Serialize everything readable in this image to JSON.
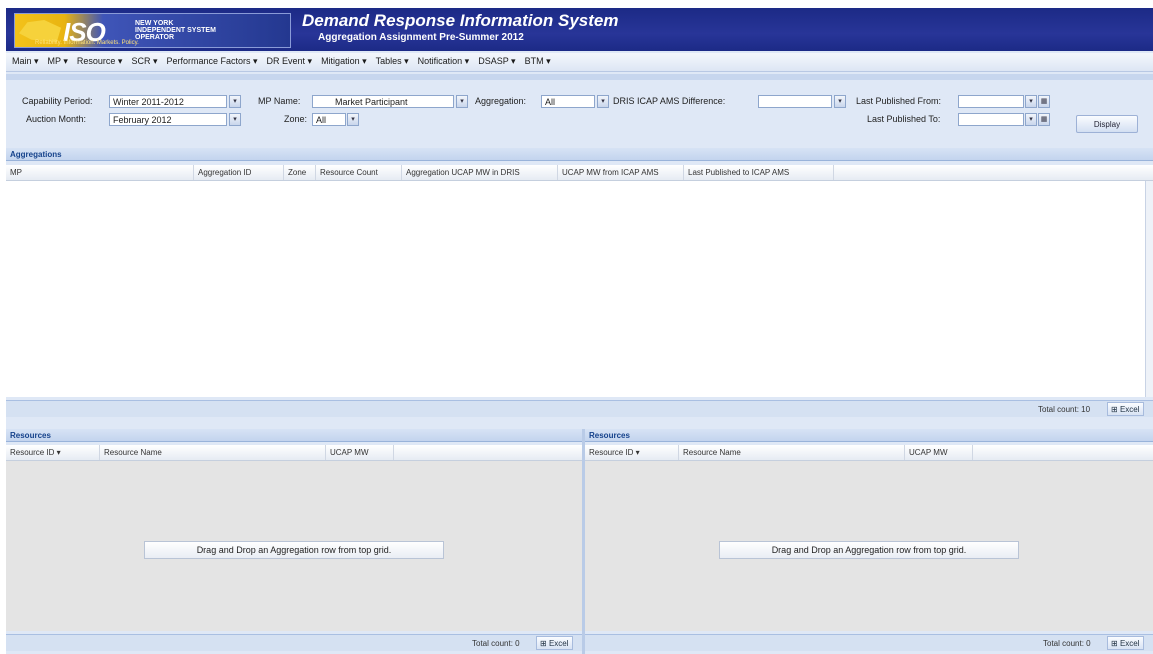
{
  "header": {
    "logo_text": "ISO",
    "logo_tagline": "NEW YORK INDEPENDENT SYSTEM OPERATOR",
    "logo_subtag": "Reliability. Information. Markets. Policy.",
    "title": "Demand Response Information System",
    "subtitle": "Aggregation Assignment Pre-Summer 2012"
  },
  "menu": [
    "Main ▾",
    "MP ▾",
    "Resource ▾",
    "SCR ▾",
    "Performance Factors ▾",
    "DR Event ▾",
    "Mitigation ▾",
    "Tables ▾",
    "Notification ▾",
    "DSASP ▾",
    "BTM ▾"
  ],
  "filters": {
    "capability_period_label": "Capability Period:",
    "capability_period_value": "Winter 2011-2012",
    "mp_name_label": "MP Name:",
    "mp_name_value": "Market Participant",
    "aggregation_label": "Aggregation:",
    "aggregation_value": "All",
    "diff_label": "DRIS ICAP AMS Difference:",
    "diff_value": "",
    "last_published_from_label": "Last Published From:",
    "last_published_from_value": "",
    "auction_month_label": "Auction Month:",
    "auction_month_value": "February 2012",
    "zone_label": "Zone:",
    "zone_value": "All",
    "last_published_to_label": "Last Published To:",
    "last_published_to_value": "",
    "display_button": "Display"
  },
  "aggregations": {
    "title": "Aggregations",
    "columns": [
      "MP",
      "Aggregation ID",
      "Zone",
      "Resource Count",
      "Aggregation UCAP MW in DRIS",
      "UCAP MW from ICAP AMS",
      "Last Published to ICAP AMS"
    ],
    "total": "Total count: 10",
    "excel": "Excel"
  },
  "resources_left": {
    "title": "Resources",
    "columns": [
      "Resource ID ▾",
      "Resource Name",
      "UCAP MW"
    ],
    "drop_message": "Drag and Drop an Aggregation row from top grid.",
    "total": "Total count: 0",
    "excel": "Excel"
  },
  "resources_right": {
    "title": "Resources",
    "columns": [
      "Resource ID ▾",
      "Resource Name",
      "UCAP MW"
    ],
    "drop_message": "Drag and Drop an Aggregation row from top grid.",
    "total": "Total count: 0",
    "excel": "Excel"
  }
}
